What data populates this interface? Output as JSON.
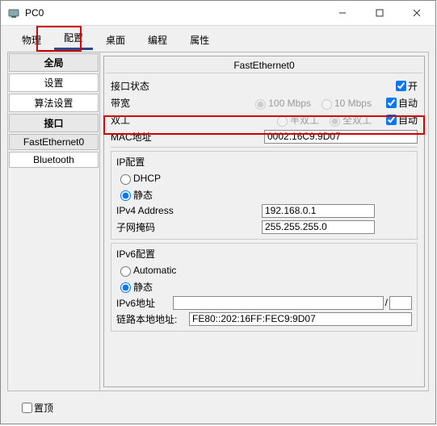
{
  "window": {
    "title": "PC0"
  },
  "tabs": {
    "physical": "物理",
    "config": "配置",
    "desktop": "桌面",
    "programming": "编程",
    "attributes": "属性"
  },
  "sidebar": {
    "group_global": "全局",
    "settings": "设置",
    "algorithm": "算法设置",
    "group_interface": "接口",
    "fe0": "FastEthernet0",
    "bt": "Bluetooth"
  },
  "panel": {
    "heading": "FastEthernet0",
    "if_status": "接口状态",
    "on": "开",
    "bandwidth": "带宽",
    "bw_100": "100 Mbps",
    "bw_10": "10 Mbps",
    "auto1": "自动",
    "duplex": "双工",
    "half": "半双工",
    "full": "全双工",
    "auto2": "自动",
    "mac_label": "MAC地址",
    "mac_value": "0002.16C9.9D07",
    "ip_cfg": "IP配置",
    "dhcp": "DHCP",
    "static": "静态",
    "ipv4_label": "IPv4 Address",
    "ipv4_value": "192.168.0.1",
    "mask_label": "子网掩码",
    "mask_value": "255.255.255.0",
    "ipv6_cfg": "IPv6配置",
    "automatic": "Automatic",
    "static6": "静态",
    "ipv6_label": "IPv6地址",
    "ipv6_value": "",
    "ipv6_slash": "/",
    "ll_label": "链路本地地址:",
    "ll_value": "FE80::202:16FF:FEC9:9D07"
  },
  "footer": {
    "top": "置顶"
  }
}
